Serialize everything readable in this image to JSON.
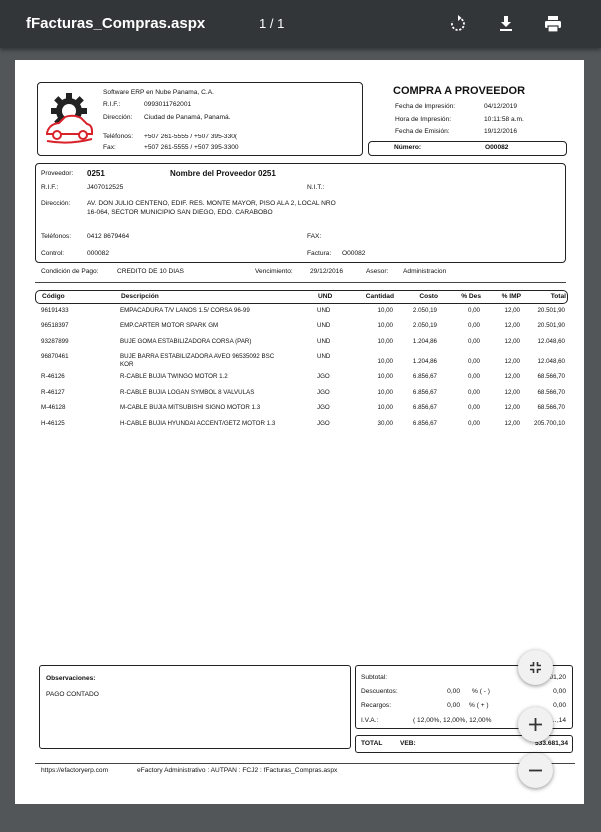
{
  "viewer": {
    "title": "fFacturas_Compras.aspx",
    "page_indicator": "1 / 1"
  },
  "company": {
    "name": "Software ERP en Nube Panama, C.A.",
    "rif_label": "R.I.F.:",
    "rif": "0993011762001",
    "address_label": "Dirección:",
    "address": "Ciudad de Panamá, Panamá.",
    "phones_label": "Teléfonos:",
    "phones": "+507 261-5555 / +507 395-330(",
    "fax_label": "Fax:",
    "fax": "+507 261-5555 / +507 395-3300"
  },
  "doc": {
    "title": "COMPRA A PROVEEDOR",
    "print_date_label": "Fecha de Impresión:",
    "print_date": "04/12/2019",
    "print_time_label": "Hora de Impresión:",
    "print_time": "10:11:58 a.m.",
    "issue_date_label": "Fecha de Emisión:",
    "issue_date": "19/12/2016",
    "number_label": "Número:",
    "number": "O00082"
  },
  "supplier": {
    "label": "Proveedor:",
    "code": "0251",
    "name": "Nombre del Proveedor 0251",
    "rif_label": "R.I.F.:",
    "rif": "J407012525",
    "nit_label": "N.I.T.:",
    "address_label": "Dirección:",
    "address_line1": "AV. DON JULIO CENTENO, EDIF. RES. MONTE MAYOR, PISO ALA 2, LOCAL NRO",
    "address_line2": "16-064, SECTOR MUNICIPIO SAN DIEGO, EDO. CARABOBO",
    "phones_label": "Teléfonos:",
    "phones": "0412 8679464",
    "fax_label": "FAX:",
    "control_label": "Control:",
    "control": "000082",
    "invoice_label": "Factura:",
    "invoice": "O00082"
  },
  "terms": {
    "payment_label": "Condición de Pago:",
    "payment": "CREDITO DE 10 DIAS",
    "due_label": "Vencimiento:",
    "due": "29/12/2016",
    "advisor_label": "Asesor:",
    "advisor": "Administracion"
  },
  "columns": [
    "Código",
    "Descripción",
    "UND",
    "Cantidad",
    "Costo",
    "% Des",
    "% IMP",
    "Total"
  ],
  "items": [
    {
      "code": "96191433",
      "desc": "EMPACADURA T/V LANOS 1.5/ CORSA 96-99",
      "desc2": "",
      "und": "UND",
      "qty": "10,00",
      "cost": "2.050,19",
      "des": "0,00",
      "imp": "12,00",
      "total": "20.501,90"
    },
    {
      "code": "96518397",
      "desc": "EMP.CARTER MOTOR SPARK GM",
      "desc2": "",
      "und": "UND",
      "qty": "10,00",
      "cost": "2.050,19",
      "des": "0,00",
      "imp": "12,00",
      "total": "20.501,90"
    },
    {
      "code": "93287899",
      "desc": "BUJE GOMA ESTABILIZADORA CORSA (PAR)",
      "desc2": "",
      "und": "UND",
      "qty": "10,00",
      "cost": "1.204,86",
      "des": "0,00",
      "imp": "12,00",
      "total": "12.048,60"
    },
    {
      "code": "96870461",
      "desc": "BUJE    BARRA    ESTABILIZADORA    AVEO    96535092    BSC",
      "desc2": "KOR",
      "und": "UND",
      "qty": "10,00",
      "cost": "1.204,86",
      "des": "0,00",
      "imp": "12,00",
      "total": "12.048,60"
    },
    {
      "code": "R-46126",
      "desc": "R-CABLE BUJIA TWINGO MOTOR 1.2",
      "desc2": "",
      "und": "JGO",
      "qty": "10,00",
      "cost": "6.856,67",
      "des": "0,00",
      "imp": "12,00",
      "total": "68.566,70"
    },
    {
      "code": "R-46127",
      "desc": "R-CABLE BUJIA LOGAN SYMBOL 8 VALVULAS",
      "desc2": "",
      "und": "JGO",
      "qty": "10,00",
      "cost": "6.856,67",
      "des": "0,00",
      "imp": "12,00",
      "total": "68.566,70"
    },
    {
      "code": "M-46128",
      "desc": "M-CABLE BUJIA MITSUBISHI SIGNO MOTOR 1.3",
      "desc2": "",
      "und": "JGO",
      "qty": "10,00",
      "cost": "6.856,67",
      "des": "0,00",
      "imp": "12,00",
      "total": "68.566,70"
    },
    {
      "code": "H-46125",
      "desc": "H-CABLE BUJIA HYUNDAI ACCENT/GETZ MOTOR 1.3",
      "desc2": "",
      "und": "JGO",
      "qty": "30,00",
      "cost": "6.856,67",
      "des": "0,00",
      "imp": "12,00",
      "total": "205.700,10"
    }
  ],
  "observations": {
    "label": "Observaciones:",
    "text": "PAGO CONTADO"
  },
  "totals": {
    "subtotal_label": "Subtotal:",
    "subtotal": "…01,20",
    "discounts_label": "Descuentos:",
    "discounts_pct": "0,00",
    "discounts_sign": "% ( - )",
    "discounts": "0,00",
    "charges_label": "Recargos:",
    "charges_pct": "0,00",
    "charges_sign": "% ( + )",
    "charges": "0,00",
    "iva_label": "I.V.A.:",
    "iva_rates": "( 12,00%, 12,00%, 12,00%",
    "iva": "…,14",
    "total_label": "TOTAL",
    "currency": "VEB:",
    "total": "533.681,34"
  },
  "footer": {
    "url": "https://efactoryerp.com",
    "system": "eFactory Administrativo  :  AUTPAN  :  FCJ2  :  fFacturas_Compras.aspx"
  },
  "icons": {
    "rotate": "rotate-icon",
    "download": "download-icon",
    "print": "print-icon",
    "fit": "fit-page-icon",
    "zoom_in": "zoom-in-icon",
    "zoom_out": "zoom-out-icon"
  },
  "colors": {
    "toolbar": "#323639",
    "viewer_bg": "#525659",
    "logo_red": "#d9222a"
  }
}
